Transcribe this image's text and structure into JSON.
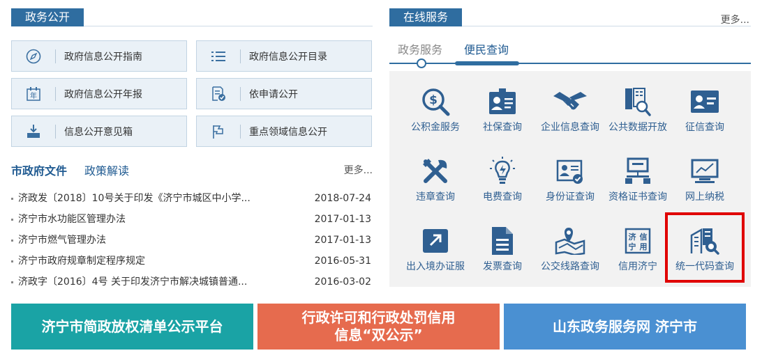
{
  "left": {
    "section_title": "政务公开",
    "quick_links": [
      {
        "label": "政府信息公开指南",
        "icon": "compass-icon"
      },
      {
        "label": "政府信息公开目录",
        "icon": "list-icon"
      },
      {
        "label": "政府信息公开年报",
        "icon": "calendar-year-icon",
        "icon_text": "年"
      },
      {
        "label": "依申请公开",
        "icon": "form-check-icon"
      },
      {
        "label": "信息公开意见箱",
        "icon": "inbox-icon"
      },
      {
        "label": "重点领域信息公开",
        "icon": "flag-icon"
      }
    ],
    "tabs": {
      "active": "市政府文件",
      "other": "政策解读",
      "more": "更多..."
    },
    "news": [
      {
        "title": "济政发〔2018〕10号关于印发《济宁市城区中小学...",
        "date": "2018-07-24"
      },
      {
        "title": "济宁市水功能区管理办法",
        "date": "2017-01-13"
      },
      {
        "title": "济宁市燃气管理办法",
        "date": "2017-01-13"
      },
      {
        "title": "济宁市政府规章制定程序规定",
        "date": "2016-05-31"
      },
      {
        "title": "济政字〔2016〕4号 关于印发济宁市解决城镇普通...",
        "date": "2016-03-02"
      }
    ]
  },
  "right": {
    "section_title": "在线服务",
    "more": "更多...",
    "tabs": [
      "政务服务",
      "便民查询"
    ],
    "services": [
      {
        "label": "公积金服务",
        "icon": "fund-search-icon"
      },
      {
        "label": "社保查询",
        "icon": "id-card-icon"
      },
      {
        "label": "企业信息查询",
        "icon": "handshake-icon"
      },
      {
        "label": "公共数据开放",
        "icon": "data-search-icon"
      },
      {
        "label": "征信查询",
        "icon": "credit-card-icon"
      },
      {
        "label": "违章查询",
        "icon": "tools-icon"
      },
      {
        "label": "电费查询",
        "icon": "lightbulb-icon"
      },
      {
        "label": "身份证查询",
        "icon": "id-check-icon"
      },
      {
        "label": "资格证书查询",
        "icon": "network-icon"
      },
      {
        "label": "网上纳税",
        "icon": "monitor-chart-icon"
      },
      {
        "label": "出入境办证服",
        "icon": "external-link-icon"
      },
      {
        "label": "发票查询",
        "icon": "document-icon"
      },
      {
        "label": "公交线路查询",
        "icon": "map-pin-icon"
      },
      {
        "label": "信用济宁",
        "icon": "seal-icon",
        "icon_text": "济信宁用"
      },
      {
        "label": "统一代码查询",
        "icon": "building-search-icon"
      }
    ]
  },
  "banners": [
    {
      "label": "济宁市简政放权清单公示平台",
      "color": "#1aa3a5"
    },
    {
      "label": "行政许可和行政处罚信用\n信息“双公示”",
      "color": "#e66b4e"
    },
    {
      "label": "山东政务服务网 济宁市",
      "color": "#4a90d2"
    }
  ],
  "colors": {
    "primary": "#2f6da0",
    "highlight": "#e00000",
    "icon": "#2f5f91"
  }
}
